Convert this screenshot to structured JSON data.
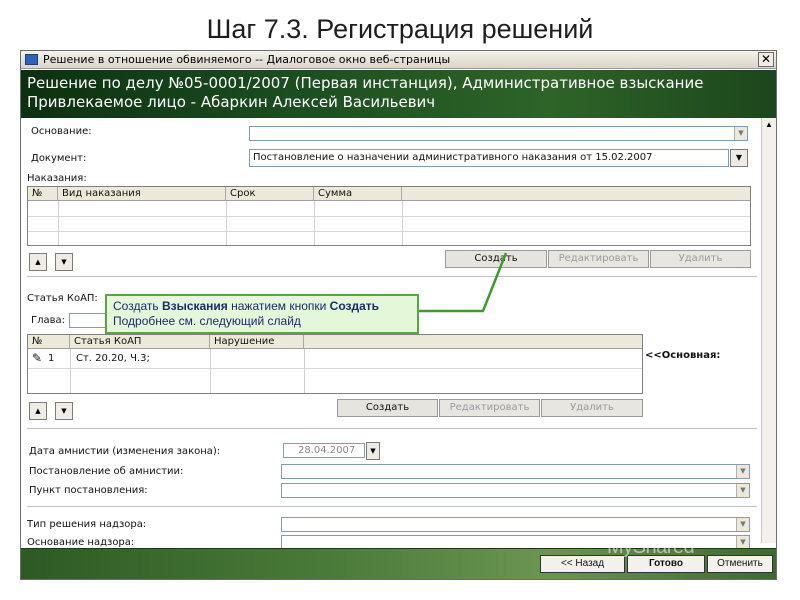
{
  "slide": {
    "title": "Шаг 7.3. Регистрация решений"
  },
  "window": {
    "title": "Решение в отношение обвиняемого -- Диалоговое окно веб-страницы",
    "close_glyph": "✕"
  },
  "banner": {
    "line1": "Решение по делу №05-0001/2007 (Первая инстанция), Административное взыскание",
    "line2": "Привлекаемое лицо - Абаркин Алексей Васильевич"
  },
  "form": {
    "osnovanie_label": "Основание:",
    "osnovanie_value": "",
    "document_label": "Документ:",
    "document_value": "Постановление о назначении административного наказания от 15.02.2007",
    "nakazaniya_label": "Наказания:",
    "nakazaniya_table": {
      "headers": [
        "№",
        "Вид наказания",
        "Срок",
        "Сумма"
      ]
    },
    "nakazaniya_buttons": {
      "create": "Создать",
      "edit": "Редактировать",
      "delete": "Удалить"
    },
    "statya_label": "Статья КоАП:",
    "glava_label": "Глава:",
    "statya_table": {
      "headers": [
        "№",
        "Статья КоАП",
        "Нарушение"
      ],
      "rows": [
        {
          "num": "1",
          "article": "Ст. 20.20, Ч.3;",
          "violation": ""
        }
      ]
    },
    "osnovnaya_label": "<<Основная:",
    "statya_buttons": {
      "create": "Создать",
      "edit": "Редактировать",
      "delete": "Удалить"
    },
    "amnesty_date_label": "Дата амнистии (изменения закона):",
    "amnesty_date_value": "28.04.2007",
    "amnesty_resolution_label": "Постановление об амнистии:",
    "resolution_item_label": "Пункт постановления:",
    "supervision_type_label": "Тип решения надзора:",
    "supervision_basis_label": "Основание надзора:"
  },
  "callout": {
    "text1": "Создать ",
    "bold1": "Взыскания",
    "text2": " нажатием кнопки ",
    "bold2": "Создать",
    "line2": "Подробнее см. следующий слайд"
  },
  "footer": {
    "back": "<< Назад",
    "done": "Готово",
    "cancel": "Отменить"
  },
  "watermark": "MyShared"
}
